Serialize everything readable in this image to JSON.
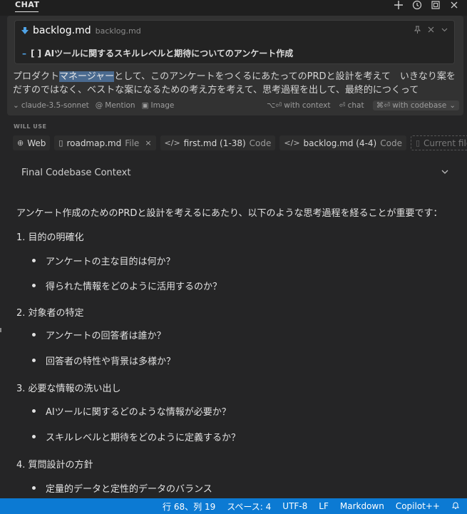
{
  "panel": {
    "title": "CHAT"
  },
  "colors": {
    "accent": "#0c7ad3",
    "background": "#252526",
    "selection": "#4a6a8f"
  },
  "file_card": {
    "name": "backlog.md",
    "path": "backlog.md",
    "content": "[ ] AIツールに関するスキルレベルと期待についてのアンケート作成",
    "dash": "–"
  },
  "prompt": {
    "before": "プロダクト",
    "selected": "マネージャー",
    "after_line1": "として、このアンケートをつくるにあたってのPRDと設計を考えて　いきなり案を",
    "line2": "だすのではなく、ベストな案になるための考え方を考えて、思考過程を出して、最終的につくって"
  },
  "toolbar": {
    "model": "claude-3.5-sonnet",
    "mention": "Mention",
    "image": "Image",
    "with_context": "⌥⏎ with context",
    "chat": "⏎ chat",
    "with_codebase": "⌘⏎ with codebase"
  },
  "will_use": {
    "label": "WILL USE",
    "chips": [
      {
        "icon": "globe-icon",
        "glyph": "⊕",
        "label": "Web",
        "sub": ""
      },
      {
        "icon": "file-icon",
        "glyph": "▯",
        "label": "roadmap.md",
        "sub": "File",
        "close": "×"
      },
      {
        "icon": "code-icon",
        "glyph": "</>",
        "label": "first.md (1-38)",
        "sub": "Code"
      },
      {
        "icon": "code-icon",
        "glyph": "</>",
        "label": "backlog.md (4-4)",
        "sub": "Code"
      },
      {
        "icon": "file-icon",
        "glyph": "▯",
        "label": "Current file",
        "sub": "",
        "plus": "+"
      }
    ]
  },
  "context": {
    "label": "Final Codebase Context"
  },
  "answer": {
    "intro": "アンケート作成のためのPRDと設計を考えるにあたり、以下のような思考過程を経ることが重要です：",
    "sections": [
      {
        "heading": "1. 目的の明確化",
        "items": [
          "アンケートの主な目的は何か？",
          "得られた情報をどのように活用するのか？"
        ]
      },
      {
        "heading": "2. 対象者の特定",
        "items": [
          "アンケートの回答者は誰か？",
          "回答者の特性や背景は多様か？"
        ]
      },
      {
        "heading": "3. 必要な情報の洗い出し",
        "items": [
          "AIツールに関するどのような情報が必要か？",
          "スキルレベルと期待をどのように定義するか？"
        ]
      },
      {
        "heading": "4. 質問設計の方針",
        "items": [
          "定量的データと定性的データのバランス"
        ]
      }
    ]
  },
  "status": {
    "position": "行 68、列 19",
    "spaces": "スペース: 4",
    "encoding": "UTF-8",
    "eol": "LF",
    "language": "Markdown",
    "extension": "Copilot++"
  }
}
